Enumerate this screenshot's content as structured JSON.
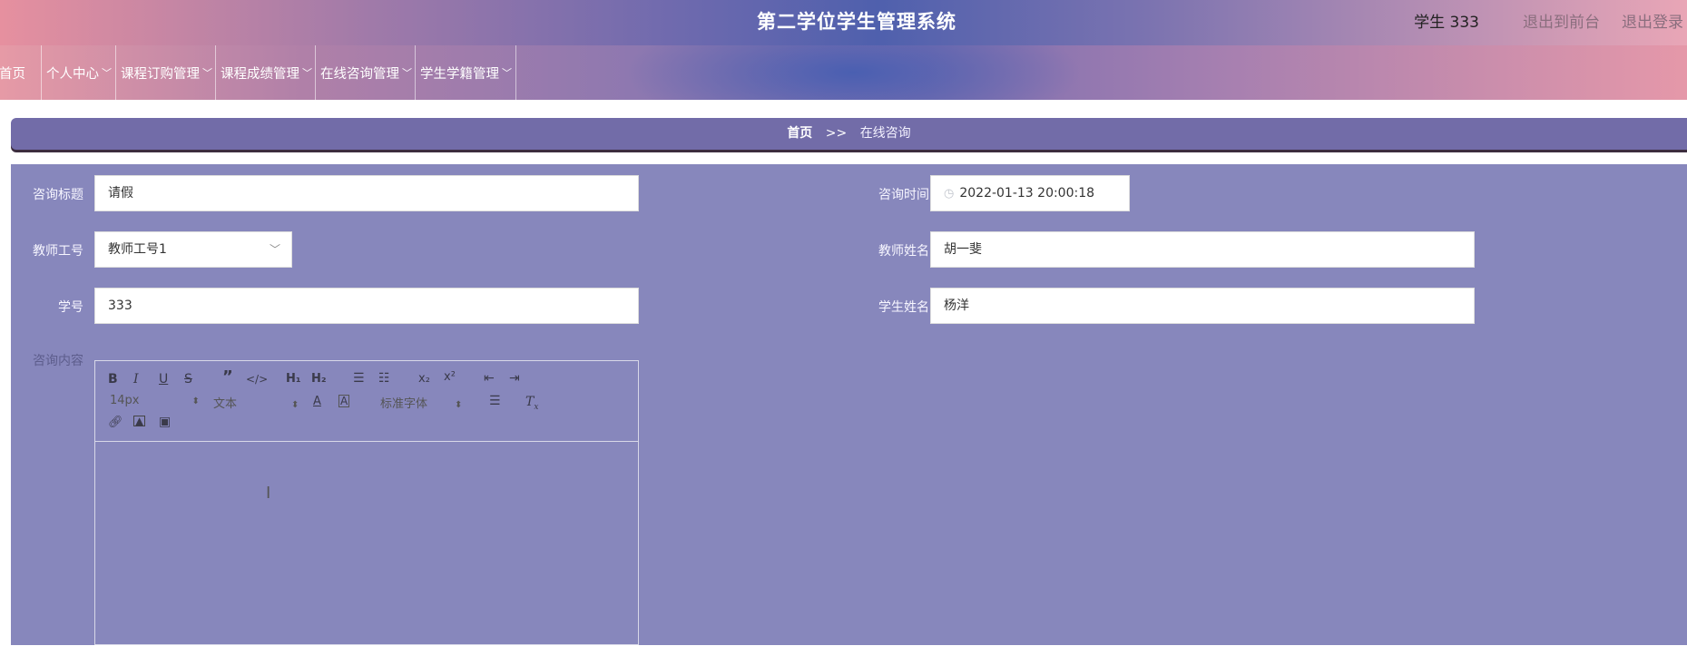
{
  "header": {
    "title": "第二学位学生管理系统",
    "user": "学生 333",
    "exit_front": "退出到前台",
    "logout": "退出登录"
  },
  "nav": {
    "home": "首页",
    "items": [
      "个人中心",
      "课程订购管理",
      "课程成绩管理",
      "在线咨询管理",
      "学生学籍管理"
    ]
  },
  "breadcrumb": {
    "home": "首页",
    "separator": ">>",
    "current": "在线咨询"
  },
  "form": {
    "title_label": "咨询标题",
    "title_value": "请假",
    "time_label": "咨询时间",
    "time_value": "2022-01-13 20:00:18",
    "teacher_id_label": "教师工号",
    "teacher_id_value": "教师工号1",
    "teacher_name_label": "教师姓名",
    "teacher_name_value": "胡一斐",
    "student_id_label": "学号",
    "student_id_value": "333",
    "student_name_label": "学生姓名",
    "student_name_value": "杨洋",
    "content_label": "咨询内容"
  },
  "editor": {
    "font_size": "14px",
    "header_type": "文本",
    "font_family": "标准字体",
    "content": ""
  },
  "colors": {
    "panel_bg": "#8787bc",
    "breadcrumb_bg": "#726ca8"
  }
}
